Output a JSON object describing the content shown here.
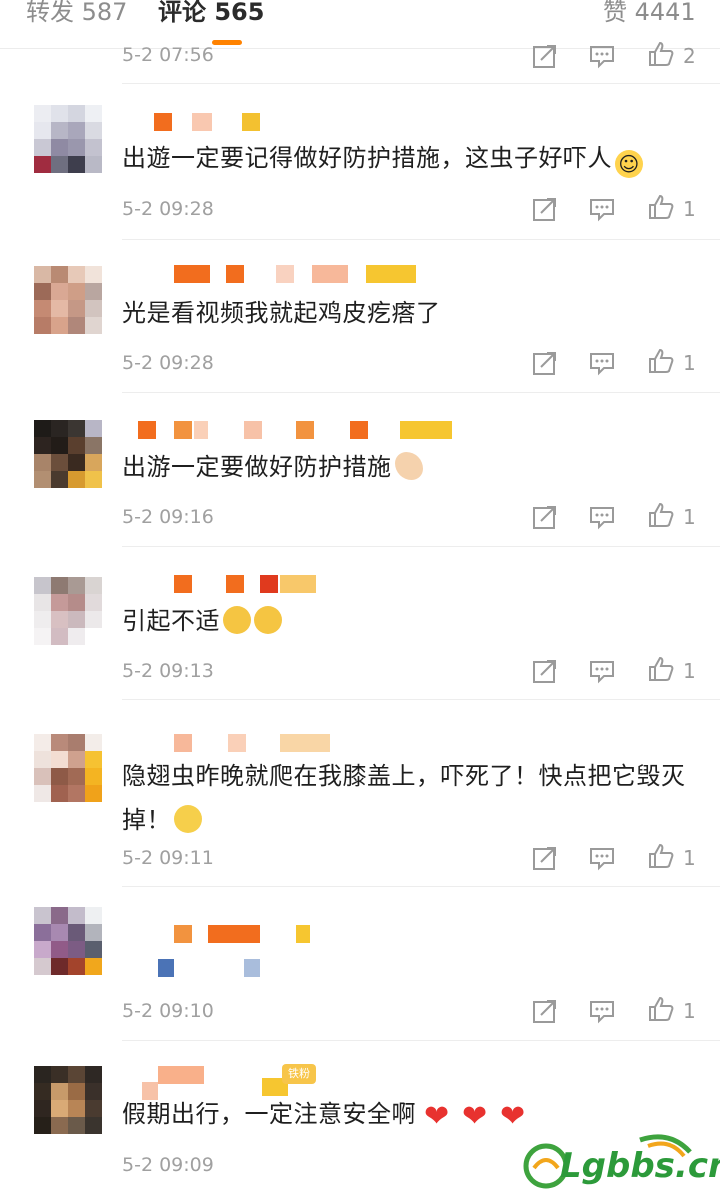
{
  "tabs": [
    {
      "label": "转发 587"
    },
    {
      "label": "评论 565"
    },
    {
      "label": "赞 4441"
    }
  ],
  "colors": {
    "accent": "#ff8200",
    "heart": "#e8322f",
    "logo": "#2c9a3a"
  },
  "top_row": {
    "time": "5-2 07:56",
    "likes": "2"
  },
  "comments": [
    {
      "text": "出遊一定要记得做好防护措施，这虫子好吓人",
      "time": "5-2 09:28",
      "likes": "1"
    },
    {
      "text": "光是看视频我就起鸡皮疙瘩了",
      "time": "5-2 09:28",
      "likes": "1"
    },
    {
      "text": "出游一定要做好防护措施",
      "time": "5-2 09:16",
      "likes": "1"
    },
    {
      "text": "引起不适",
      "time": "5-2 09:13",
      "likes": "1"
    },
    {
      "text": "隐翅虫昨晚就爬在我膝盖上，吓死了！快点把它毁灭掉！",
      "time": "5-2 09:11",
      "likes": "1"
    },
    {
      "text": "",
      "time": "5-2 09:10",
      "likes": "1"
    },
    {
      "text": "假期出行，一定注意安全啊",
      "time": "5-2 09:09",
      "likes": ""
    }
  ],
  "badge": "铁粉",
  "watermark": "Lgbbs.cn",
  "icons": [
    "share-icon",
    "comment-icon",
    "like-icon",
    "smile-emoji",
    "hand-emoji",
    "sweat-emoji",
    "sad-emoji",
    "heart-emoji"
  ]
}
